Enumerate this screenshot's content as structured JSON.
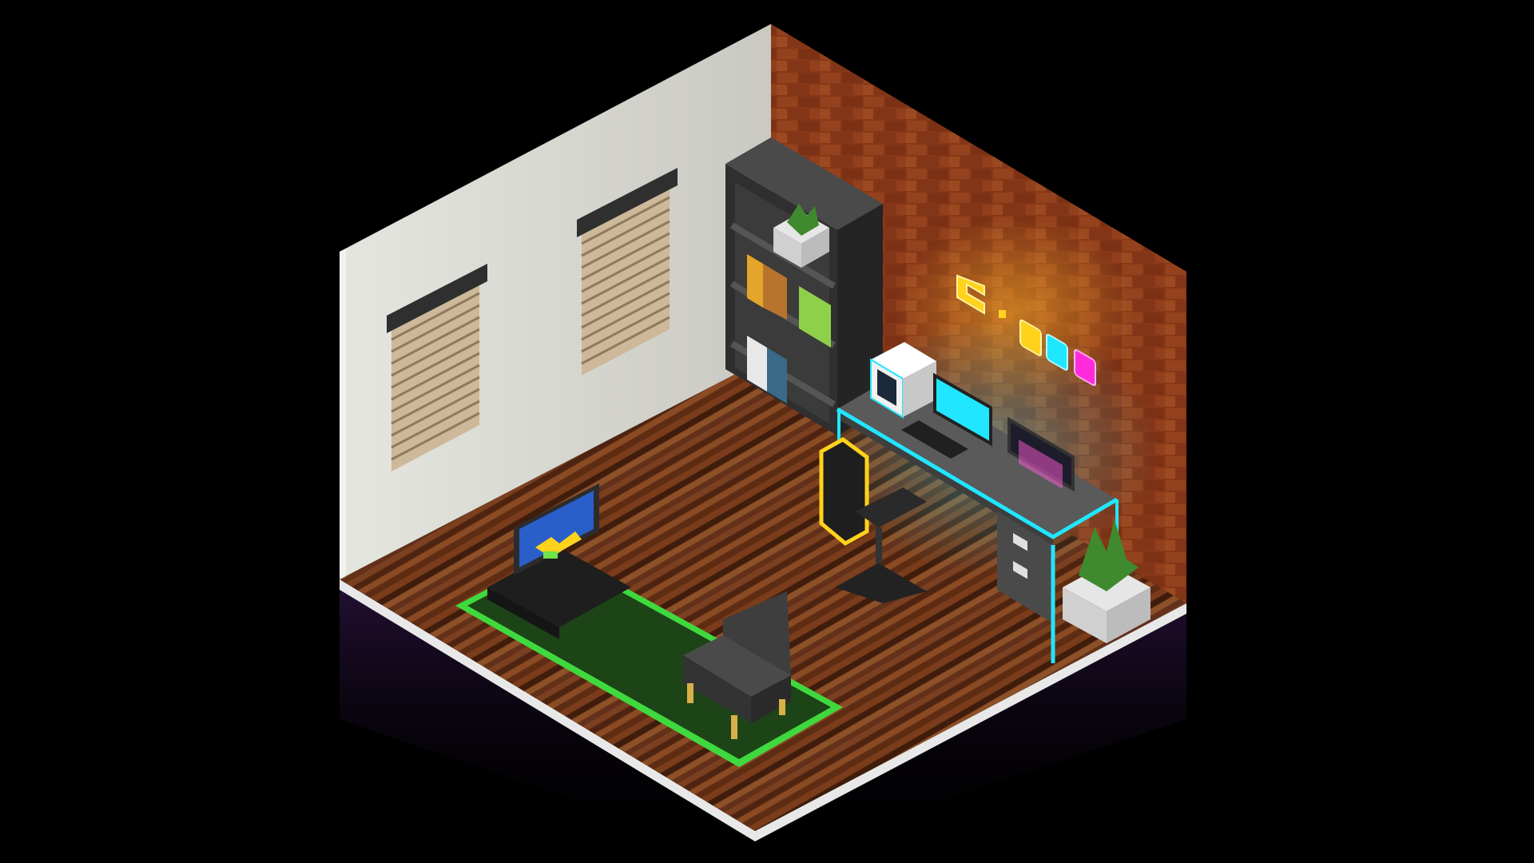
{
  "scene": {
    "type": "isometric voxel render",
    "subject": "gaming room",
    "background": "#000000"
  },
  "palette": {
    "wall_left": "#dcdcd6",
    "wall_brick": "#9a3f1c",
    "mortar": "#d6a58a",
    "floor": "#6a3417",
    "floor_edge": "#e8e8e8",
    "rug": "#1c4417",
    "rug_border": "#3fd93f",
    "shelf": "#3d3d3d",
    "desk": "#4e4e4e",
    "neon_cyan": "#21e6ff",
    "neon_yellow": "#ffd21c",
    "neon_magenta": "#ff2ad9",
    "blind": "#cdb89a"
  },
  "neon_sign": {
    "shapes": [
      "pacman",
      "dot",
      "ghost-yellow",
      "ghost-cyan",
      "ghost-magenta"
    ]
  },
  "objects": [
    "left-wall",
    "brick-wall",
    "floor",
    "window-blinds-1",
    "window-blinds-2",
    "bookshelf",
    "potted-plant-shelf",
    "desk",
    "pc-case",
    "monitor-cyan",
    "monitor-side",
    "keyboard",
    "gaming-chair",
    "tv-stand",
    "tv",
    "rug",
    "armchair",
    "potted-plant-floor"
  ]
}
